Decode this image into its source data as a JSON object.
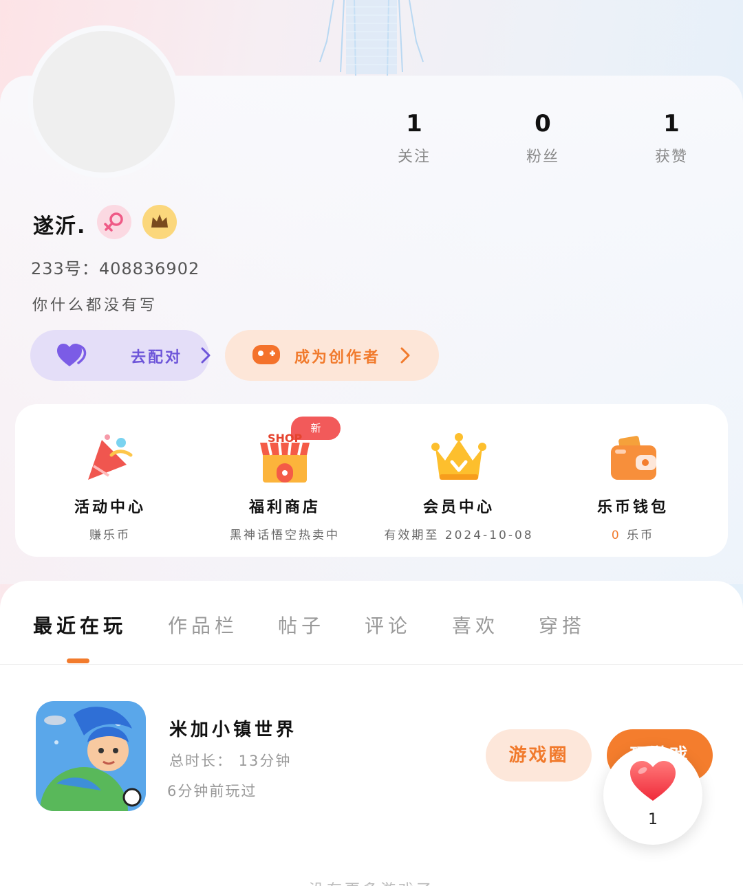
{
  "profile": {
    "username": "遂沂.",
    "id_label": "233号：",
    "id_value": "408836902",
    "bio": "你什么都没有写"
  },
  "stats": [
    {
      "value": "1",
      "label": "关注"
    },
    {
      "value": "0",
      "label": "粉丝"
    },
    {
      "value": "1",
      "label": "获赞"
    }
  ],
  "actions": {
    "match_label": "去配对",
    "creator_label": "成为创作者"
  },
  "services": [
    {
      "title": "活动中心",
      "subtitle": "赚乐币"
    },
    {
      "title": "福利商店",
      "subtitle": "黑神话悟空热卖中",
      "badge": "新",
      "icon_text": "SHOP"
    },
    {
      "title": "会员中心",
      "subtitle": "有效期至 2024-10-08"
    },
    {
      "title": "乐币钱包",
      "subtitle_value": "0",
      "subtitle_unit": "乐币"
    }
  ],
  "tabs": [
    "最近在玩",
    "作品栏",
    "帖子",
    "评论",
    "喜欢",
    "穿搭"
  ],
  "active_tab": "最近在玩",
  "recent_game": {
    "name": "米加小镇世界",
    "duration": "总时长：  13分钟",
    "last_played": "6分钟前玩过",
    "circle_button": "游戏圈",
    "play_button": "玩游戏"
  },
  "floating_like": {
    "count": "1"
  },
  "bottom_hint": "没有更多游戏了",
  "colors": {
    "accent_orange": "#f47d2d",
    "match_purple": "#6d55d9",
    "badge_red": "#f25a5a"
  }
}
